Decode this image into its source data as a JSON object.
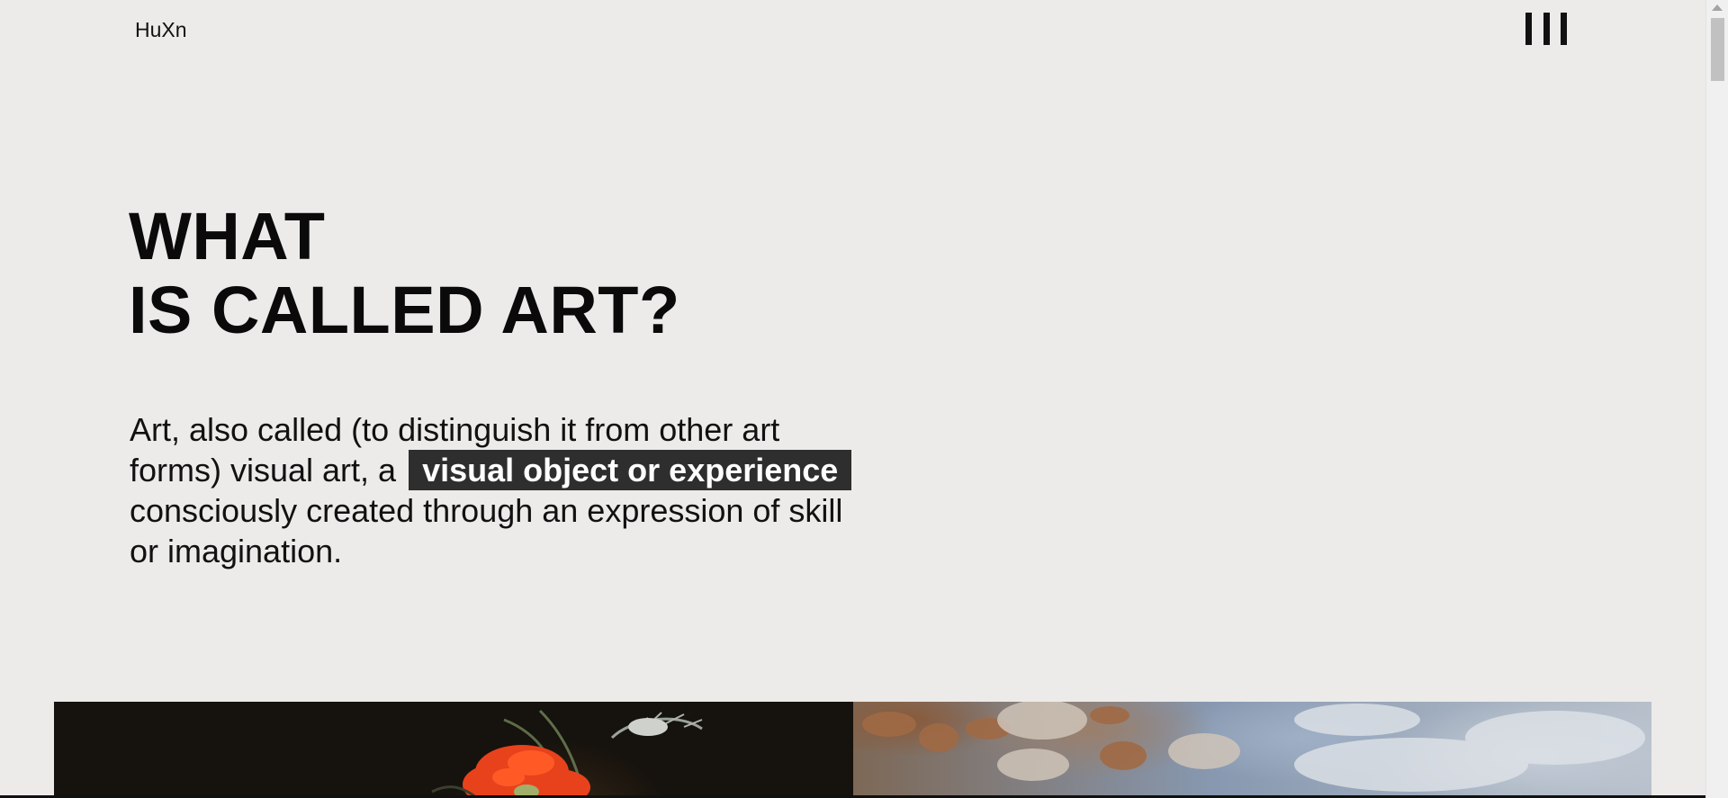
{
  "header": {
    "logo": "HuXn",
    "menu_icon": "menu-bars-icon"
  },
  "hero": {
    "title_line1": "WHAT",
    "title_line2": "IS CALLED ART?",
    "lead_before": "Art, also called (to distinguish it from other art forms) visual art, a",
    "lead_highlight": "visual object or experience",
    "lead_after": "consciously created through an expression of skill or imagination."
  },
  "gallery": {
    "images": [
      "flower-still-life-painting",
      "baroque-sky-ceiling-painting"
    ]
  },
  "colors": {
    "background": "#edebe9",
    "text": "#0a0a0a",
    "highlight_bg": "#2e2e2e",
    "highlight_text": "#ffffff"
  }
}
